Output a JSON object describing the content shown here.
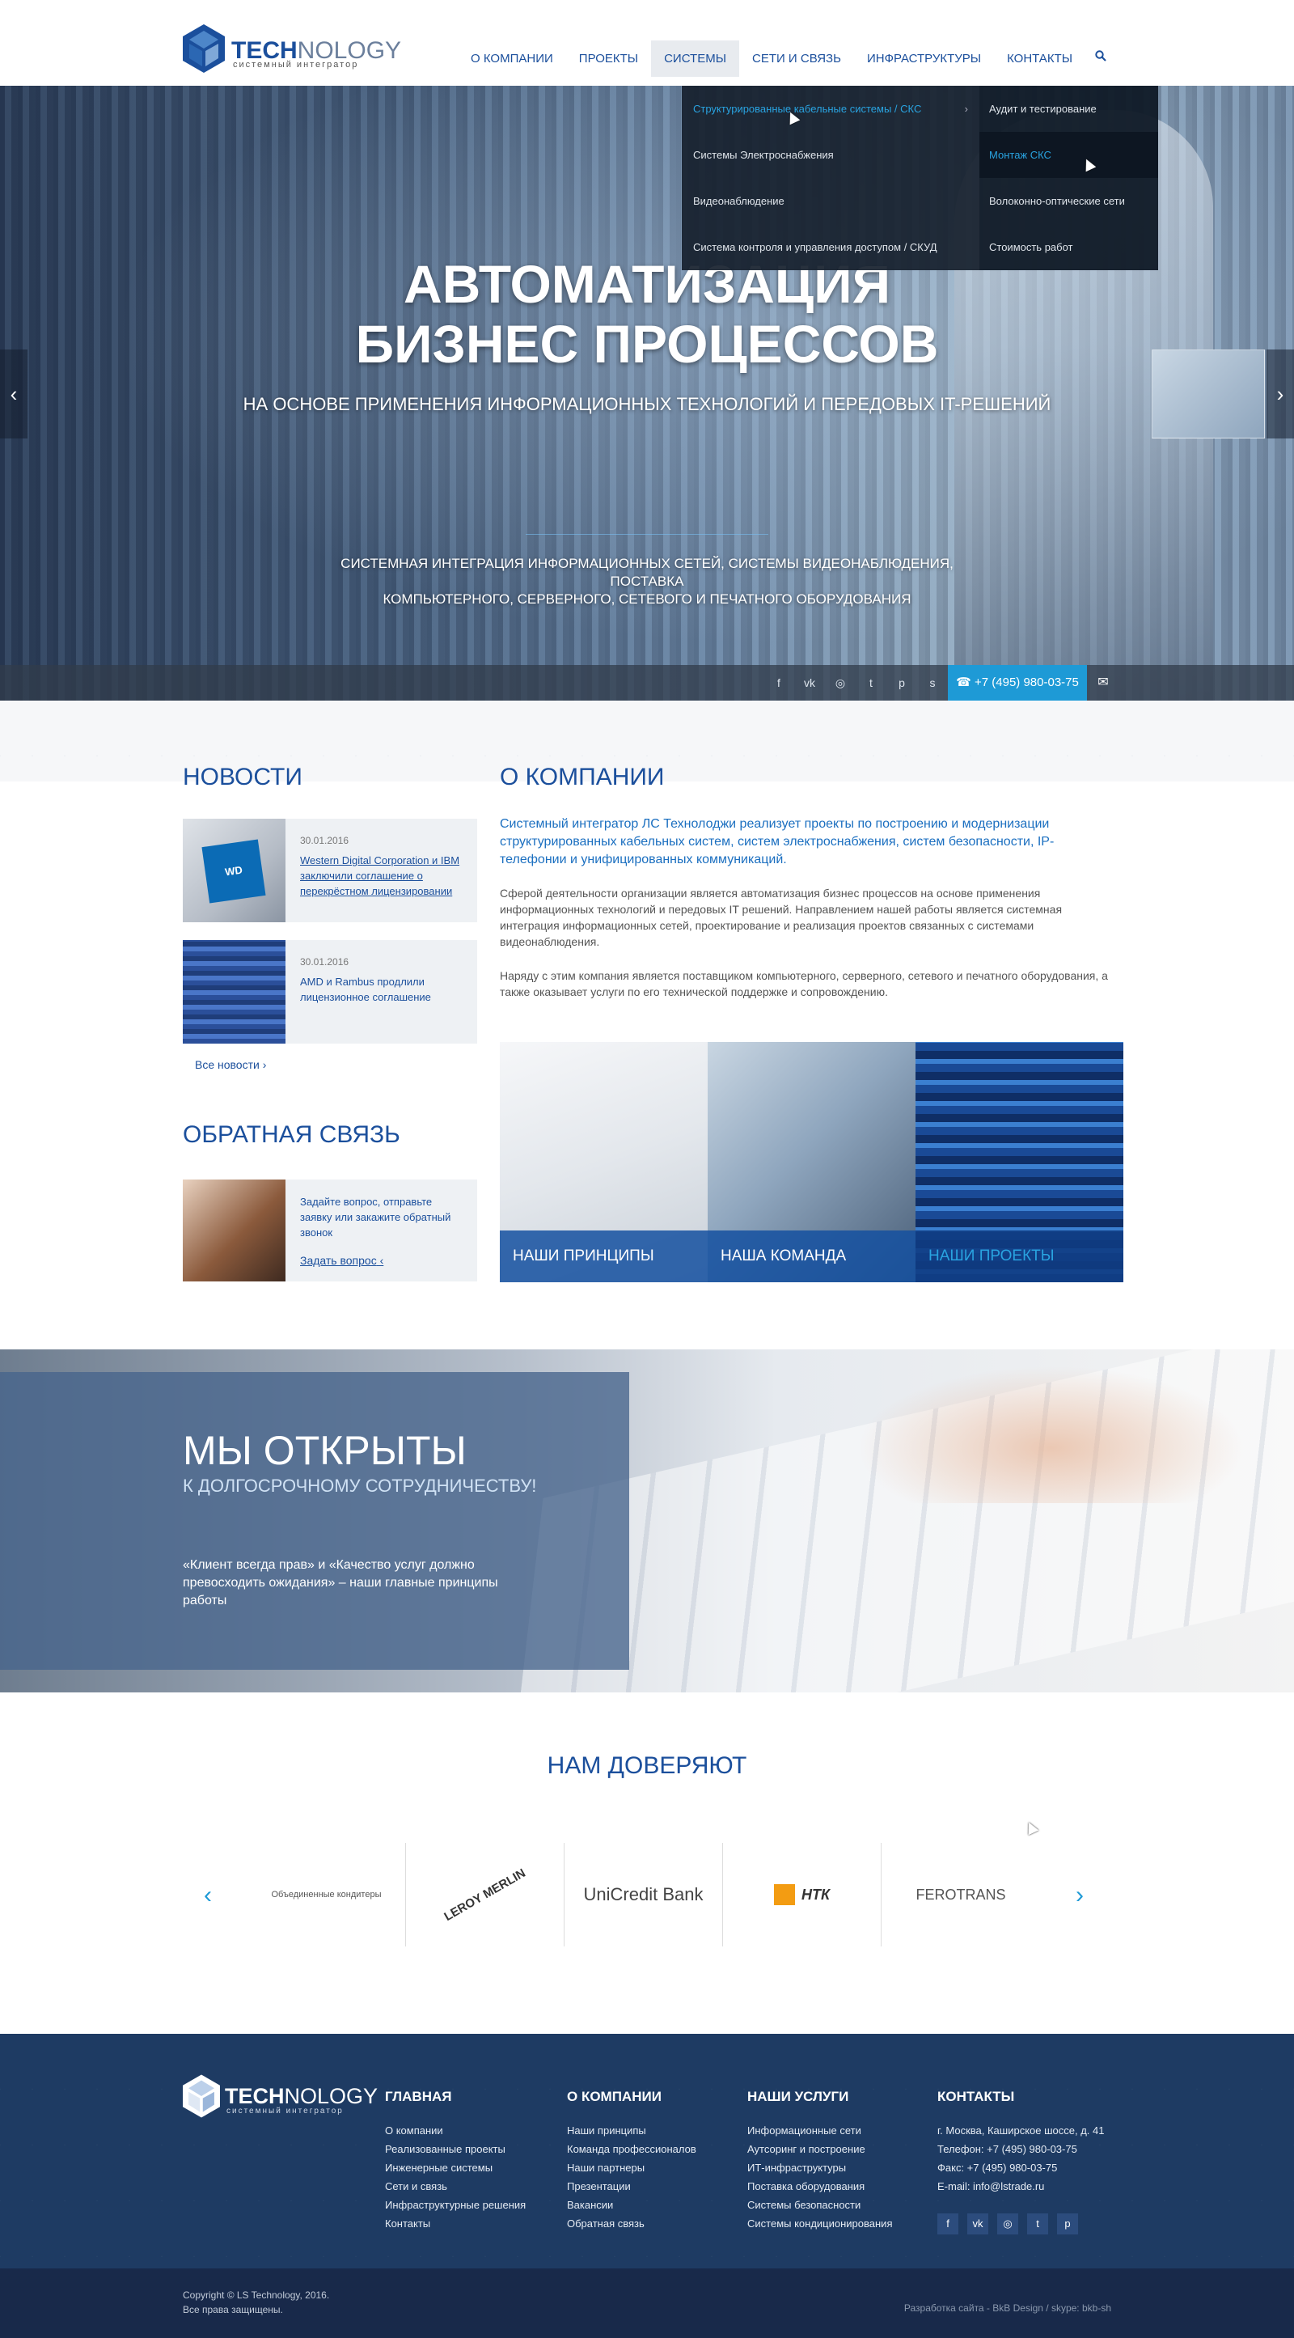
{
  "header": {
    "logo": {
      "name_bold": "TECH",
      "name_rest": "NOLOGY",
      "tagline": "системный интегратор"
    },
    "nav": [
      "О КОМПАНИИ",
      "ПРОЕКТЫ",
      "СИСТЕМЫ",
      "СЕТИ И СВЯЗЬ",
      "ИНФРАСТРУКТУРЫ",
      "КОНТАКТЫ"
    ],
    "active_nav": "СИСТЕМЫ"
  },
  "dropdown": {
    "main": [
      "Структурированные кабельные системы / СКС",
      "Системы Электроснабжения",
      "Видеонаблюдение",
      "Система контроля и управления доступом / СКУД"
    ],
    "sub": [
      "Аудит и тестирование",
      "Монтаж СКС",
      "Волоконно-оптические сети",
      "Стоимость работ"
    ]
  },
  "hero": {
    "title_line1": "АВТОМАТИЗАЦИЯ",
    "title_line2": "БИЗНЕС ПРОЦЕССОВ",
    "subtitle": "НА ОСНОВЕ ПРИМЕНЕНИЯ ИНФОРМАЦИОННЫХ ТЕХНОЛОГИЙ И ПЕРЕДОВЫХ IT-РЕШЕНИЙ",
    "desc_line1": "СИСТЕМНАЯ ИНТЕГРАЦИЯ ИНФОРМАЦИОННЫХ СЕТЕЙ, СИСТЕМЫ ВИДЕОНАБЛЮДЕНИЯ, ПОСТАВКА",
    "desc_line2": "КОМПЬЮТЕРНОГО, СЕРВЕРНОГО, СЕТЕВОГО И ПЕЧАТНОГО ОБОРУДОВАНИЯ",
    "phone": "+7 (495) 980-03-75"
  },
  "news": {
    "title": "НОВОСТИ",
    "items": [
      {
        "date": "30.01.2016",
        "text": "Western Digital Corporation и IBM заключили соглашение о перекрёстном лицензировании"
      },
      {
        "date": "30.01.2016",
        "text": "AMD и Rambus продлили лицензионное соглашение"
      }
    ],
    "all_link": "Все новости"
  },
  "feedback": {
    "title": "ОБРАТНАЯ СВЯЗЬ",
    "text": "Задайте вопрос, отправьте заявку или закажите обратный звонок",
    "link": "Задать вопрос"
  },
  "about": {
    "title": "О КОМПАНИИ",
    "lead": "Системный интегратор ЛС Технолоджи реализует проекты по построению и модернизации структурированных кабельных систем, систем электроснабжения, систем безопасности, IP-телефонии и унифицированных коммуникаций.",
    "p1": "Сферой деятельности организации является автоматизация бизнес процессов на основе применения информационных технологий и передовых IT решений. Направлением нашей работы является системная интеграция информационных сетей, проектирование и реализация проектов связанных с системами видеонаблюдения.",
    "p2": "Наряду с этим компания является поставщиком  компьютерного, серверного, сетевого и печатного оборудования, а также оказывает услуги по его технической поддержке и сопровождению.",
    "tiles": [
      "НАШИ ПРИНЦИПЫ",
      "НАША КОМАНДА",
      "НАШИ ПРОЕКТЫ"
    ]
  },
  "open": {
    "title": "МЫ ОТКРЫТЫ",
    "subtitle": "К ДОЛГОСРОЧНОМУ СОТРУДНИЧЕСТВУ!",
    "text": "«Клиент всегда прав» и «Качество услуг должно превосходить ожидания» – наши главные принципы работы"
  },
  "trust": {
    "title": "НАМ ДОВЕРЯЮТ",
    "logos": [
      "Объединенные кондитеры",
      "LEROY MERLIN",
      "UniCredit Bank",
      "НТК",
      "FEROTRANS"
    ]
  },
  "footer": {
    "logo": {
      "name_bold": "TECH",
      "name_rest": "NOLOGY",
      "tagline": "системный интегратор"
    },
    "cols": [
      {
        "title": "ГЛАВНАЯ",
        "items": [
          "О компании",
          "Реализованные проекты",
          "Инженерные системы",
          "Сети и связь",
          "Инфраструктурные решения",
          "Контакты"
        ]
      },
      {
        "title": "О КОМПАНИИ",
        "items": [
          "Наши принципы",
          "Команда профессионалов",
          "Наши партнеры",
          "Презентации",
          "Вакансии",
          "Обратная связь"
        ]
      },
      {
        "title": "НАШИ УСЛУГИ",
        "items": [
          "Информационные сети",
          "Аутсоринг и построение",
          "ИТ-инфраструктуры",
          "Поставка оборудования",
          "Системы безопасности",
          "Системы кондиционирования"
        ]
      },
      {
        "title": "КОНТАКТЫ",
        "items": [
          "г. Москва, Каширское шоссе, д. 41",
          "Телефон: +7 (495) 980-03-75",
          "Факс: +7 (495) 980-03-75",
          "E-mail: info@lstrade.ru"
        ]
      }
    ],
    "copyright_line1": "Copyright © LS Technology, 2016.",
    "copyright_line2": "Все права защищены.",
    "dev": "Разработка сайта - BkB Design / skype: bkb-sh"
  }
}
